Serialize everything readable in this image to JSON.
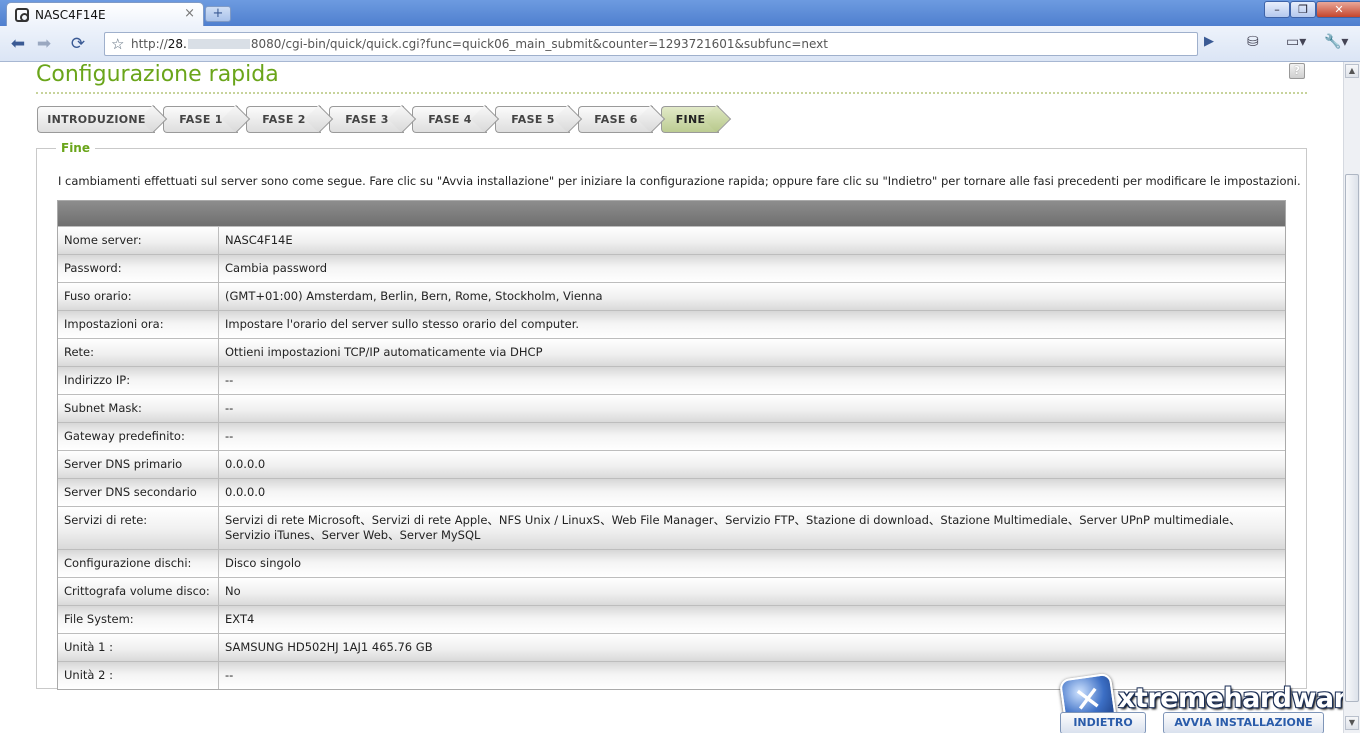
{
  "browser": {
    "tab_title": "NASC4F14E",
    "tab_close": "×",
    "new_tab": "+",
    "url_prefix": "http://",
    "url_host": "28.",
    "url_rest": "8080/cgi-bin/quick/quick.cgi?func=quick06_main_submit&counter=1293721601&subfunc=next",
    "minimize": "–",
    "restore": "❐",
    "close": "✕"
  },
  "page": {
    "title": "Configurazione rapida",
    "help": "?",
    "steps": [
      "INTRODUZIONE",
      "FASE 1",
      "FASE 2",
      "FASE 3",
      "FASE 4",
      "FASE 5",
      "FASE 6",
      "FINE"
    ],
    "active_step": "FINE",
    "legend": "Fine",
    "intro": "I cambiamenti effettuati sul server sono come segue. Fare clic su \"Avvia installazione\" per iniziare la configurazione rapida; oppure fare clic su \"Indietro\" per tornare alle fasi precedenti per modificare le impostazioni."
  },
  "summary": [
    {
      "label": "Nome server:",
      "value": "NASC4F14E"
    },
    {
      "label": "Password:",
      "value": "Cambia password"
    },
    {
      "label": "Fuso orario:",
      "value": "(GMT+01:00) Amsterdam, Berlin, Bern, Rome, Stockholm, Vienna"
    },
    {
      "label": "Impostazioni ora:",
      "value": "Impostare l'orario del server sullo stesso orario del computer."
    },
    {
      "label": "Rete:",
      "value": "Ottieni impostazioni TCP/IP automaticamente via DHCP"
    },
    {
      "label": "Indirizzo IP:",
      "value": "--"
    },
    {
      "label": "Subnet Mask:",
      "value": "--"
    },
    {
      "label": "Gateway predefinito:",
      "value": "--"
    },
    {
      "label": "Server DNS primario",
      "value": "0.0.0.0"
    },
    {
      "label": "Server DNS secondario",
      "value": "0.0.0.0"
    },
    {
      "label": "Servizi di rete:",
      "value": "Servizi di rete Microsoft、Servizi di rete Apple、NFS Unix / LinuxS、Web File Manager、Servizio FTP、Stazione di download、Stazione Multimediale、Server UPnP multimediale、Servizio iTunes、Server Web、Server MySQL"
    },
    {
      "label": "Configurazione dischi:",
      "value": "Disco singolo"
    },
    {
      "label": "Crittografa volume disco:",
      "value": "No"
    },
    {
      "label": "File System:",
      "value": "EXT4"
    },
    {
      "label": "Unità 1 :",
      "value": "SAMSUNG HD502HJ 1AJ1 465.76 GB"
    },
    {
      "label": "Unità 2 :",
      "value": "--"
    }
  ],
  "buttons": {
    "back": "INDIETRO",
    "start": "AVVIA INSTALLAZIONE"
  },
  "watermark": {
    "text": "xtremehardware.it"
  }
}
